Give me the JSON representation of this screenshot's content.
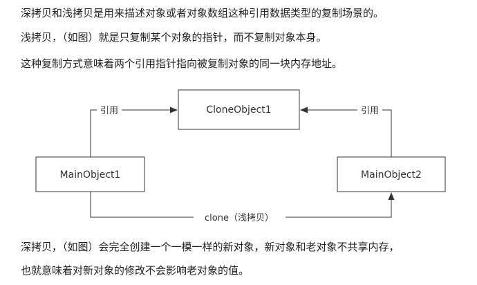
{
  "paragraphs": {
    "p1": "深拷贝和浅拷贝是用来描述对象或者对象数组这种引用数据类型的复制场景的。",
    "p2": "浅拷贝，（如图）就是只复制某个对象的指针，而不复制对象本身。",
    "p3": "这种复制方式意味着两个引用指针指向被复制对象的同一块内存地址。",
    "p4": "深拷贝，（如图）会完全创建一个一模一样的新对象，新对象和老对象不共享内存，",
    "p5": "也就意味着对新对象的修改不会影响老对象的值。"
  },
  "diagram": {
    "nodes": {
      "clone": "CloneObject1",
      "main1": "MainObject1",
      "main2": "MainObject2"
    },
    "edges": {
      "ref_left": "引用",
      "ref_right": "引用",
      "clone_edge": "clone（浅拷贝）"
    }
  }
}
